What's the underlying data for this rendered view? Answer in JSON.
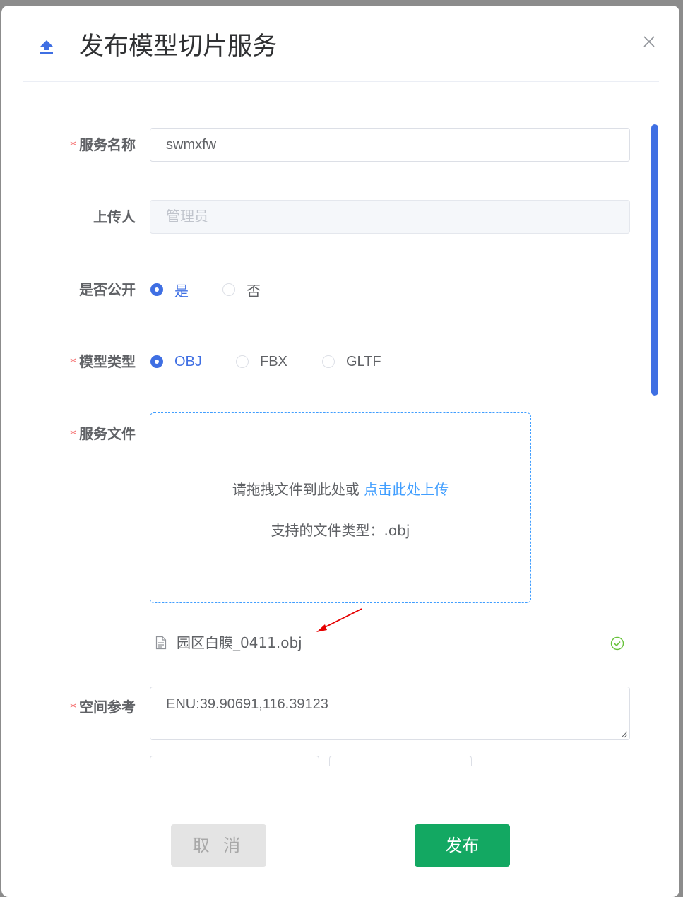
{
  "dialog": {
    "title": "发布模型切片服务"
  },
  "form": {
    "service_name": {
      "label": "服务名称",
      "required": true,
      "value": "swmxfw"
    },
    "uploader": {
      "label": "上传人",
      "required": false,
      "placeholder": "管理员"
    },
    "is_public": {
      "label": "是否公开",
      "required": false,
      "options": [
        {
          "label": "是",
          "checked": true
        },
        {
          "label": "否",
          "checked": false
        }
      ]
    },
    "model_type": {
      "label": "模型类型",
      "required": true,
      "options": [
        {
          "label": "OBJ",
          "checked": true
        },
        {
          "label": "FBX",
          "checked": false
        },
        {
          "label": "GLTF",
          "checked": false
        }
      ]
    },
    "service_file": {
      "label": "服务文件",
      "required": true,
      "drop_text": "请拖拽文件到此处或 ",
      "drop_link": "点击此处上传",
      "tip": "支持的文件类型：.obj",
      "uploaded_file": {
        "name": "园区白膜_0411.obj",
        "status": "success"
      }
    },
    "spatial_reference": {
      "label": "空间参考",
      "required": true,
      "value": "ENU:39.90691,116.39123"
    }
  },
  "footer": {
    "cancel_label": "取 消",
    "publish_label": "发布"
  },
  "colors": {
    "primary": "#3f6fe3",
    "link": "#409eff",
    "required": "#f56c6c",
    "publish": "#13a862",
    "success": "#67c23a",
    "annotation_arrow": "#e60000"
  }
}
